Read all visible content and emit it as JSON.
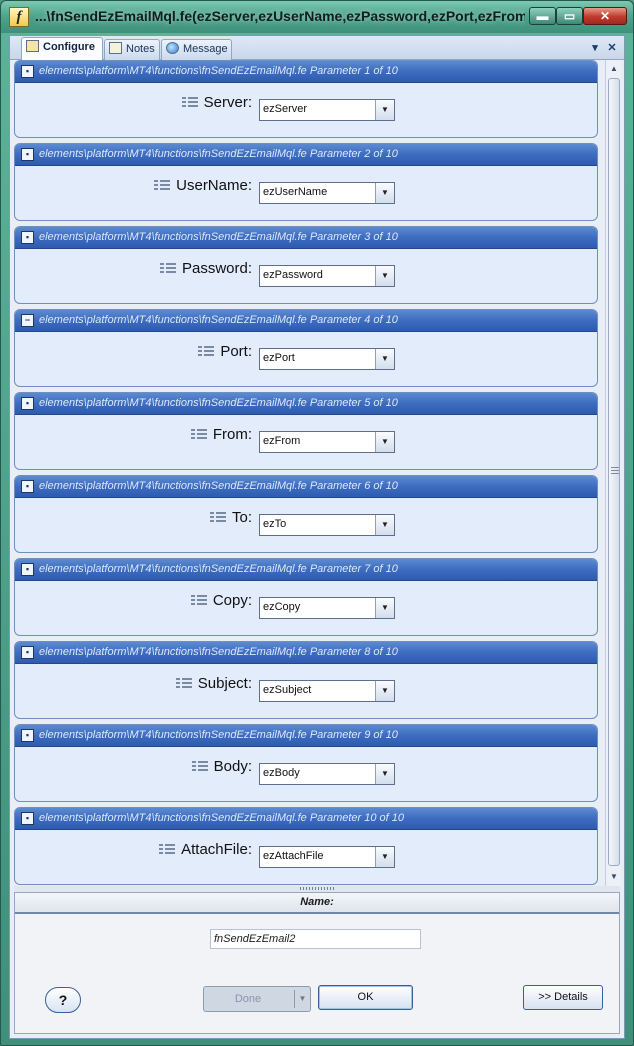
{
  "window": {
    "title": "...\\fnSendEzEmailMql.fe(ezServer,ezUserName,ezPassword,ezPort,ezFrom,...",
    "app_icon": "f",
    "minimize_glyph": "▬",
    "maximize_glyph": "▭",
    "close_glyph": "✕"
  },
  "tabs": [
    {
      "label": "Configure",
      "icon": "configure-icon",
      "active": true
    },
    {
      "label": "Notes",
      "icon": "notes-icon",
      "active": false
    },
    {
      "label": "Message",
      "icon": "message-icon",
      "active": false
    }
  ],
  "tabstrip": {
    "dropdown_glyph": "▾",
    "close_glyph": "✕"
  },
  "parameters": [
    {
      "path": "elements\\platform\\MT4\\functions\\fnSendEzEmailMql.fe  Parameter  1  of  10",
      "label": "Server:",
      "value": "ezServer",
      "icon": "▪"
    },
    {
      "path": "elements\\platform\\MT4\\functions\\fnSendEzEmailMql.fe  Parameter  2  of  10",
      "label": "UserName:",
      "value": "ezUserName",
      "icon": "▪"
    },
    {
      "path": "elements\\platform\\MT4\\functions\\fnSendEzEmailMql.fe  Parameter  3  of  10",
      "label": "Password:",
      "value": "ezPassword",
      "icon": "▪"
    },
    {
      "path": "elements\\platform\\MT4\\functions\\fnSendEzEmailMql.fe  Parameter  4  of  10",
      "label": "Port:",
      "value": "ezPort",
      "icon": "−"
    },
    {
      "path": "elements\\platform\\MT4\\functions\\fnSendEzEmailMql.fe  Parameter  5  of  10",
      "label": "From:",
      "value": "ezFrom",
      "icon": "▪"
    },
    {
      "path": "elements\\platform\\MT4\\functions\\fnSendEzEmailMql.fe  Parameter  6  of  10",
      "label": "To:",
      "value": "ezTo",
      "icon": "▪"
    },
    {
      "path": "elements\\platform\\MT4\\functions\\fnSendEzEmailMql.fe  Parameter  7  of  10",
      "label": "Copy:",
      "value": "ezCopy",
      "icon": "▪"
    },
    {
      "path": "elements\\platform\\MT4\\functions\\fnSendEzEmailMql.fe  Parameter  8  of  10",
      "label": "Subject:",
      "value": "ezSubject",
      "icon": "▪"
    },
    {
      "path": "elements\\platform\\MT4\\functions\\fnSendEzEmailMql.fe  Parameter  9  of  10",
      "label": "Body:",
      "value": "ezBody",
      "icon": "▪"
    },
    {
      "path": "elements\\platform\\MT4\\functions\\fnSendEzEmailMql.fe  Parameter  10  of  10",
      "label": "AttachFile:",
      "value": "ezAttachFile",
      "icon": "▪"
    }
  ],
  "combo_arrow": "▼",
  "scrollbar": {
    "up_glyph": "▲",
    "down_glyph": "▼"
  },
  "name_section": {
    "header": "Name:",
    "value": "fnSendEzEmail2"
  },
  "buttons": {
    "help": "?",
    "done": "Done",
    "done_arrow": "▼",
    "ok": "OK",
    "details": ">> Details"
  },
  "colors": {
    "title_bar": "#4fa58d",
    "panel_header": "#3d6cc0",
    "panel_body": "#e2ecfb",
    "client_bg": "#e9eef6"
  }
}
